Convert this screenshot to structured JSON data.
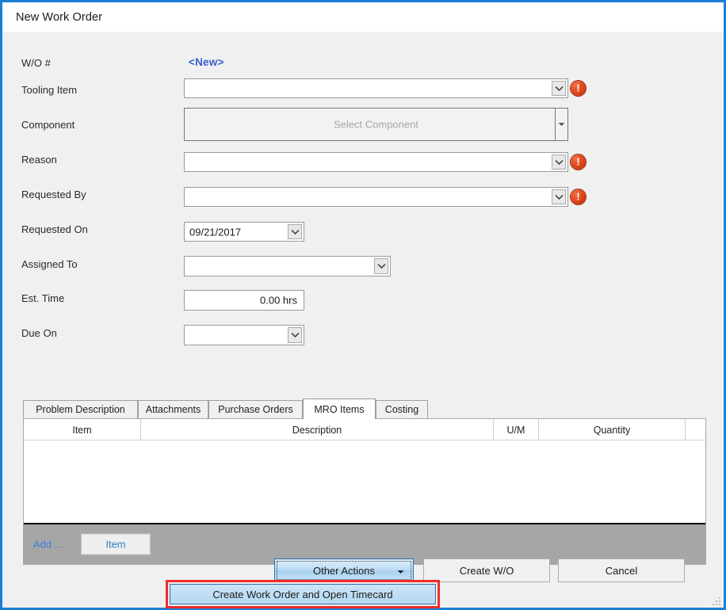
{
  "window": {
    "title": "New Work Order",
    "accent_color": "#1a7fd4",
    "background": "#f0f0f0"
  },
  "form": {
    "fields": [
      {
        "label": "W/O #",
        "value": "<New>",
        "type": "static-link"
      },
      {
        "label": "Tooling Item",
        "value": "",
        "type": "combobox",
        "error": true
      },
      {
        "label": "Component",
        "value": "",
        "placeholder": "Select Component",
        "type": "picker",
        "error": false
      },
      {
        "label": "Reason",
        "value": "",
        "type": "combobox",
        "error": true
      },
      {
        "label": "Requested By",
        "value": "",
        "type": "combobox",
        "error": true
      },
      {
        "label": "Requested On",
        "value": "09/21/2017",
        "type": "datepicker",
        "error": false
      },
      {
        "label": "Assigned To",
        "value": "",
        "type": "combobox",
        "error": false
      },
      {
        "label": "Est. Time",
        "value": "0.00 hrs",
        "type": "textbox",
        "error": false
      },
      {
        "label": "Due On",
        "value": "",
        "type": "datepicker",
        "error": false
      }
    ],
    "error_glyph": "!"
  },
  "tabs": [
    {
      "label": "Problem Description",
      "selected": false
    },
    {
      "label": "Attachments",
      "selected": false
    },
    {
      "label": "Purchase Orders",
      "selected": false
    },
    {
      "label": "MRO Items",
      "selected": true
    },
    {
      "label": "Costing",
      "selected": false
    }
  ],
  "grid": {
    "columns": [
      "Item",
      "Description",
      "U/M",
      "Quantity",
      ""
    ],
    "rows": [],
    "footer": {
      "add_label": "Add ...",
      "add_item_button": "Item"
    }
  },
  "footer_buttons": {
    "other_actions": "Other Actions",
    "create_wo": "Create W/O",
    "cancel": "Cancel"
  },
  "dropdown_menu": {
    "items": [
      {
        "label": "Create Work Order and Open Timecard",
        "highlighted": true
      }
    ],
    "annotation_color": "#f42b2b"
  }
}
